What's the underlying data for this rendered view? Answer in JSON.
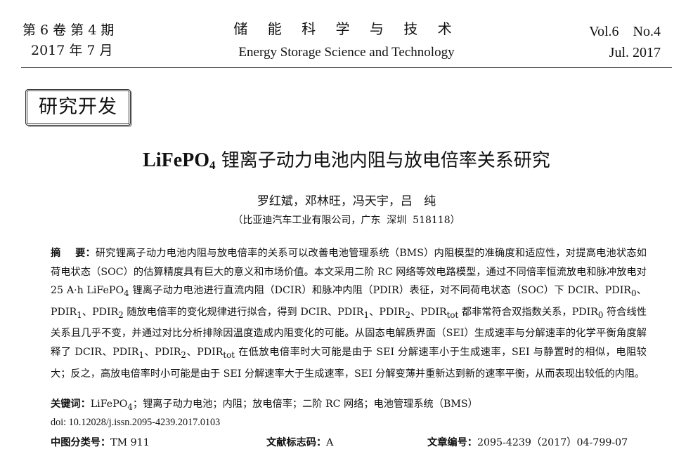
{
  "header": {
    "volume_cn": "第 6 卷 第 4 期",
    "date_cn": "2017 年 7 月",
    "journal_cn": "储 能 科 学 与 技 术",
    "journal_en": "Energy Storage Science and Technology",
    "volume_en": "Vol.6    No.4",
    "date_en": "Jul. 2017"
  },
  "section": "研究开发",
  "title": {
    "prefix": "LiFePO",
    "subscript": "4",
    "suffix": " 锂离子动力电池内阻与放电倍率关系研究"
  },
  "authors": "罗红斌，邓林旺，冯天宇，吕   纯",
  "affiliation": "（比亚迪汽车工业有限公司，广东  深圳  518118）",
  "abstract": {
    "label": "摘    要：",
    "parts": [
      "研究锂离子动力电池内阻与放电倍率的关系可以改善电池管理系统（BMS）内阻模型的准确度和适应性，对提高电池状态如荷电状态（SOC）的估算精度具有巨大的意义和市场价值。本文采用二阶 RC 网络等效电路模型，通过不同倍率恒流放电和脉冲放电对 25 A·h LiFePO",
      "4",
      " 锂离子动力电池进行直流内阻（DCIR）和脉冲内阻（PDIR）表征，对不同荷电状态（SOC）下 DCIR、PDIR",
      "0",
      "、PDIR",
      "1",
      "、PDIR",
      "2",
      " 随放电倍率的变化规律进行拟合，得到 DCIR、PDIR",
      "1",
      "、PDIR",
      "2",
      "、PDIR",
      "tot",
      " 都非常符合双指数关系，PDIR",
      "0",
      " 符合线性关系且几乎不变，并通过对比分析排除因温度造成内阻变化的可能。从固态电解质界面（SEI）生成速率与分解速率的化学平衡角度解释了 DCIR、PDIR",
      "1",
      "、PDIR",
      "2",
      "、PDIR",
      "tot",
      " 在低放电倍率时大可能是由于 SEI 分解速率小于生成速率，SEI 与静置时的相似，电阻较大；反之，高放电倍率时小可能是由于 SEI 分解速率大于生成速率，SEI 分解变薄并重新达到新的速率平衡，从而表现出较低的内阻。"
    ]
  },
  "keywords": {
    "label": "关键词：",
    "pre": "LiFePO",
    "sub": "4",
    "post": "；锂离子动力电池；内阻；放电倍率；二阶 RC 网络；电池管理系统（BMS）"
  },
  "doi": "doi: 10.12028/j.issn.2095-4239.2017.0103",
  "clc": {
    "label": "中图分类号：",
    "value": "TM 911"
  },
  "doc_code": {
    "label": "文献标志码：",
    "value": "A"
  },
  "article_no": {
    "label": "文章编号：",
    "value": "2095-4239（2017）04-799-07"
  }
}
